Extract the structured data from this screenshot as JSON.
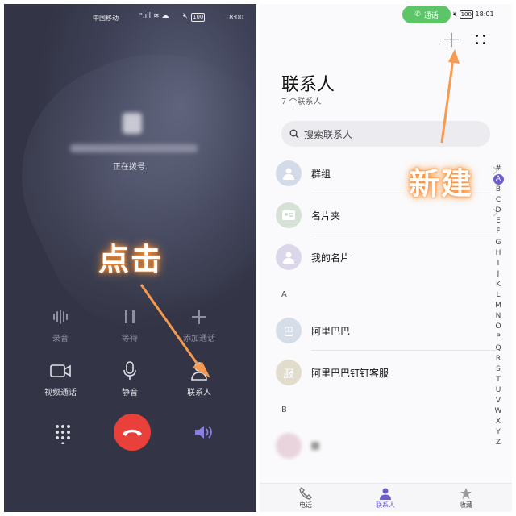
{
  "left": {
    "status": {
      "carrier": "中国移动",
      "battery": "100",
      "time": "18:00"
    },
    "dialing_text": "正在拨号.",
    "controls": [
      {
        "label": "录音",
        "icon": "waveform-icon"
      },
      {
        "label": "等待",
        "icon": "pause-icon"
      },
      {
        "label": "添加通话",
        "icon": "plus-icon"
      },
      {
        "label": "视频通话",
        "icon": "video-camera-icon"
      },
      {
        "label": "静音",
        "icon": "microphone-icon"
      },
      {
        "label": "联系人",
        "icon": "person-icon"
      }
    ],
    "overlay": "点击"
  },
  "right": {
    "call_pill": "通话",
    "status": {
      "battery": "100",
      "time": "18:01"
    },
    "title": "联系人",
    "count": "7 个联系人",
    "search_placeholder": "搜索联系人",
    "items": [
      {
        "name": "群组"
      },
      {
        "name": "名片夹"
      },
      {
        "name": "我的名片"
      }
    ],
    "section_a": "A",
    "section_b": "B",
    "contacts_a": [
      {
        "avatar": "巴",
        "name": "阿里巴巴"
      },
      {
        "avatar": "服",
        "name": "阿里巴巴钉钉客服"
      }
    ],
    "contact_b_avatar": "",
    "contact_b_name": "",
    "alphabet": [
      "#",
      "A",
      "B",
      "C",
      "D",
      "E",
      "F",
      "G",
      "H",
      "I",
      "J",
      "K",
      "L",
      "M",
      "N",
      "O",
      "P",
      "Q",
      "R",
      "S",
      "T",
      "U",
      "V",
      "W",
      "X",
      "Y",
      "Z"
    ],
    "tabs": [
      {
        "label": "电话",
        "icon": "phone-icon"
      },
      {
        "label": "联系人",
        "icon": "contacts-icon"
      },
      {
        "label": "收藏",
        "icon": "star-icon"
      }
    ],
    "overlay": "新建"
  },
  "colors": {
    "accent": "#6b5ec9",
    "end_call": "#e9413a",
    "call_pill": "#5cc568",
    "annotation": "#ff9a40"
  }
}
